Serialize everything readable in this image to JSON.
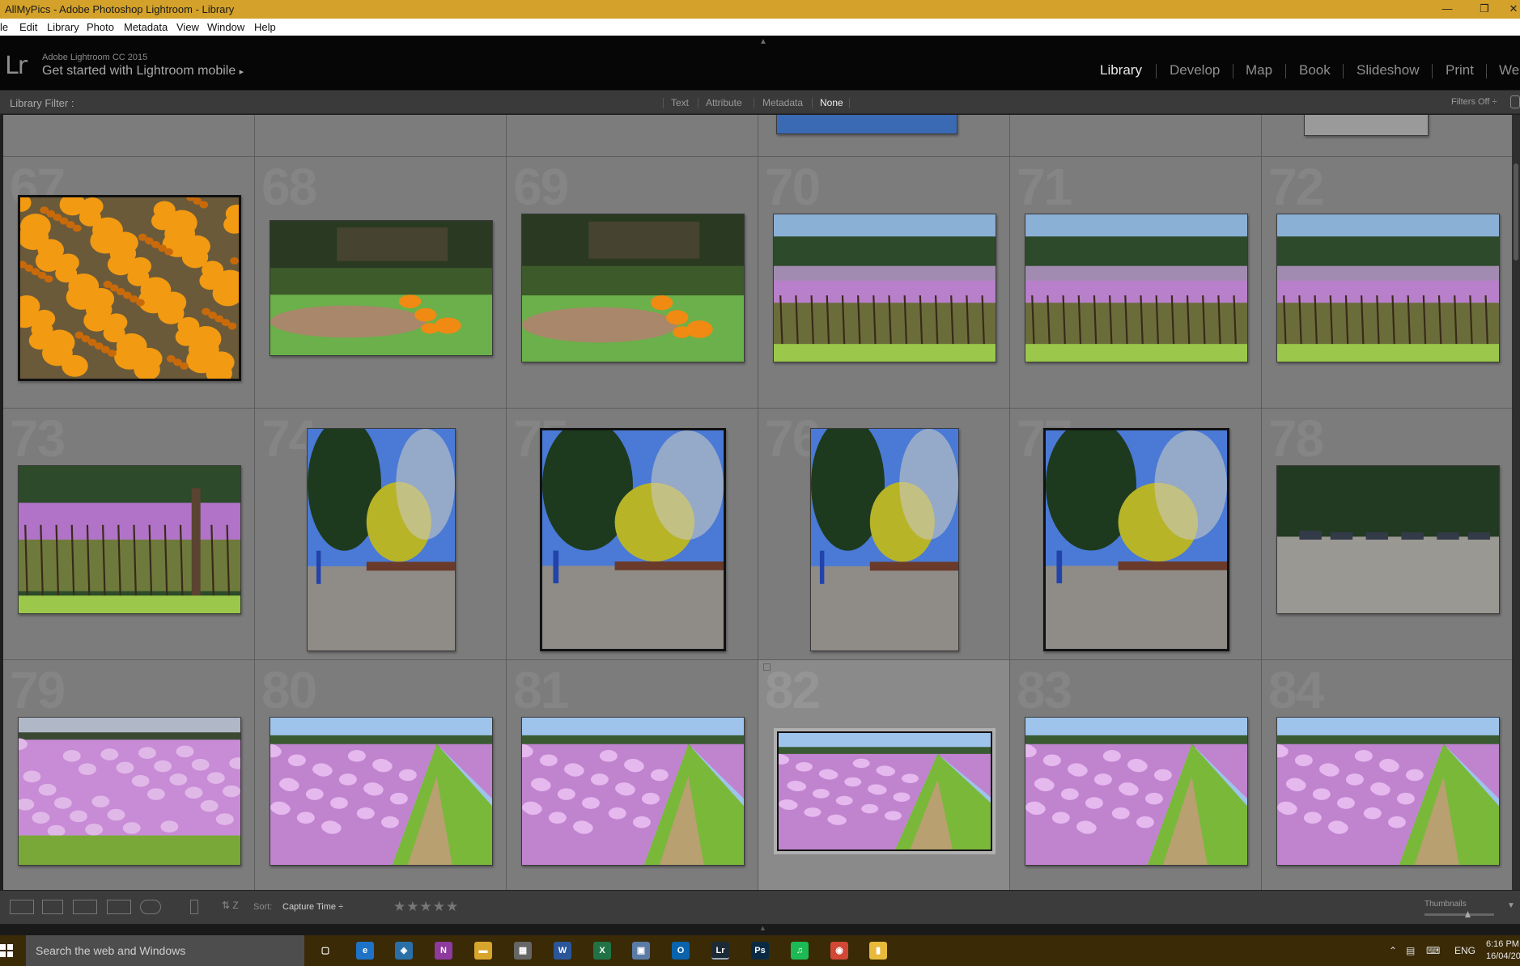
{
  "window": {
    "title": "AllMyPics - Adobe Photoshop Lightroom - Library",
    "minimize_icon": "minimize-icon",
    "restore_icon": "restore-icon",
    "close_icon": "close-icon"
  },
  "menu": [
    "le",
    "Edit",
    "Library",
    "Photo",
    "Metadata",
    "View",
    "Window",
    "Help"
  ],
  "identity": {
    "logo": "Lr",
    "product": "Adobe Lightroom CC 2015",
    "mobile": "Get started with Lightroom mobile",
    "mobile_arrow": "▸"
  },
  "modules": [
    {
      "label": "Library",
      "active": true
    },
    {
      "label": "Develop",
      "active": false
    },
    {
      "label": "Map",
      "active": false
    },
    {
      "label": "Book",
      "active": false
    },
    {
      "label": "Slideshow",
      "active": false
    },
    {
      "label": "Print",
      "active": false
    },
    {
      "label": "We",
      "active": false
    }
  ],
  "filter": {
    "label": "Library Filter :",
    "options": [
      {
        "label": "Text",
        "selected": false
      },
      {
        "label": "Attribute",
        "selected": false
      },
      {
        "label": "Metadata",
        "selected": false
      },
      {
        "label": "None",
        "selected": true
      }
    ],
    "preset": "Filters Off ÷"
  },
  "grid": {
    "rows": [
      {
        "numbers": [
          "67",
          "68",
          "69",
          "70",
          "71",
          "72"
        ]
      },
      {
        "numbers": [
          "73",
          "74",
          "75",
          "76",
          "77",
          "78"
        ]
      },
      {
        "numbers": [
          "79",
          "80",
          "81",
          "82",
          "83",
          "84"
        ]
      }
    ],
    "selected_cell": "82",
    "thumbnails": [
      {
        "num": "67",
        "subject": "orange-daisies",
        "orientation": "landscape",
        "boxed": true
      },
      {
        "num": "68",
        "subject": "garden-bank",
        "orientation": "landscape",
        "boxed": false
      },
      {
        "num": "69",
        "subject": "garden-bank",
        "orientation": "landscape",
        "boxed": false
      },
      {
        "num": "70",
        "subject": "orchard-hills",
        "orientation": "landscape",
        "boxed": false
      },
      {
        "num": "71",
        "subject": "orchard-hills",
        "orientation": "landscape",
        "boxed": false
      },
      {
        "num": "72",
        "subject": "orchard-hills",
        "orientation": "landscape",
        "boxed": false
      },
      {
        "num": "73",
        "subject": "orchard-post",
        "orientation": "landscape",
        "boxed": false
      },
      {
        "num": "74",
        "subject": "trees-carpark",
        "orientation": "portrait",
        "boxed": false
      },
      {
        "num": "75",
        "subject": "trees-carpark",
        "orientation": "portrait",
        "boxed": true
      },
      {
        "num": "76",
        "subject": "trees-carpark",
        "orientation": "portrait",
        "boxed": false
      },
      {
        "num": "77",
        "subject": "trees-carpark",
        "orientation": "portrait",
        "boxed": true
      },
      {
        "num": "78",
        "subject": "parked-cars",
        "orientation": "landscape",
        "boxed": false
      },
      {
        "num": "79",
        "subject": "blossom-orchard",
        "orientation": "landscape",
        "boxed": false
      },
      {
        "num": "80",
        "subject": "blossom-path",
        "orientation": "landscape",
        "boxed": false
      },
      {
        "num": "81",
        "subject": "blossom-path",
        "orientation": "landscape",
        "boxed": false
      },
      {
        "num": "82",
        "subject": "blossom-path",
        "orientation": "landscape",
        "boxed": false
      },
      {
        "num": "83",
        "subject": "blossom-path",
        "orientation": "landscape",
        "boxed": false
      },
      {
        "num": "84",
        "subject": "blossom-path",
        "orientation": "landscape",
        "boxed": false
      }
    ]
  },
  "toolbar": {
    "sort_label": "Sort:",
    "sort_value": "Capture Time ÷",
    "stars": "★★★★★",
    "thumbnails_label": "Thumbnails",
    "view_icons": [
      "grid-view-icon",
      "loupe-view-icon",
      "compare-view-icon",
      "survey-view-icon",
      "people-view-icon"
    ],
    "painter_icon": "painter-icon",
    "sort_direction_icon": "sort-direction-icon"
  },
  "taskbar": {
    "search_placeholder": "Search the web and Windows",
    "apps": [
      {
        "label": "▢",
        "name": "task-view-icon",
        "color": "#3a2a06"
      },
      {
        "label": "e",
        "name": "edge-icon",
        "color": "#1e73c7"
      },
      {
        "label": "◈",
        "name": "app-icon",
        "color": "#2b6fa8"
      },
      {
        "label": "N",
        "name": "onenote-icon",
        "color": "#8e3a9e"
      },
      {
        "label": "▬",
        "name": "file-explorer-icon",
        "color": "#d8a52c"
      },
      {
        "label": "▦",
        "name": "store-icon",
        "color": "#666"
      },
      {
        "label": "W",
        "name": "word-icon",
        "color": "#2b579a"
      },
      {
        "label": "X",
        "name": "excel-icon",
        "color": "#217346"
      },
      {
        "label": "▣",
        "name": "network-icon",
        "color": "#5a7ba6"
      },
      {
        "label": "O",
        "name": "outlook-icon",
        "color": "#0a64ad"
      },
      {
        "label": "Lr",
        "name": "lightroom-icon",
        "color": "#1c2a36"
      },
      {
        "label": "Ps",
        "name": "photoshop-icon",
        "color": "#0a2a44"
      },
      {
        "label": "♫",
        "name": "spotify-icon",
        "color": "#1db954"
      },
      {
        "label": "◉",
        "name": "chrome-icon",
        "color": "#d14836"
      },
      {
        "label": "▮",
        "name": "notes-icon",
        "color": "#e8b93b"
      }
    ],
    "language": "ENG",
    "time": "6:16 PM",
    "date": "16/04/20"
  }
}
